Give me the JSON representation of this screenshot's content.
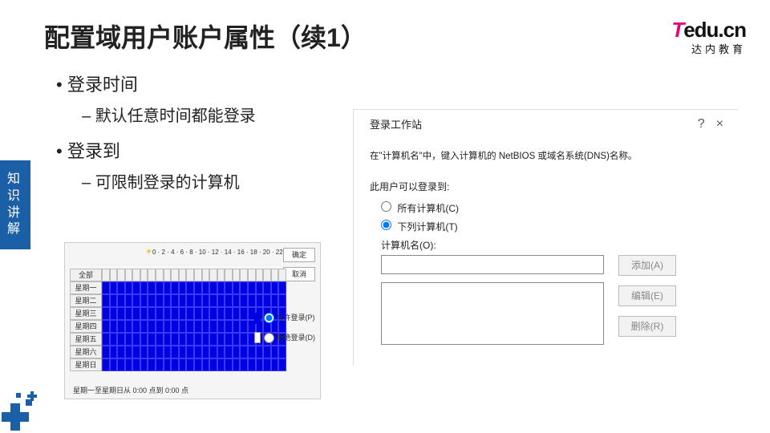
{
  "slide": {
    "title": "配置域用户账户属性（续1）",
    "side_tab": "知识讲解",
    "logo": {
      "t": "T",
      "rest": "edu.cn",
      "sub": "达内教育"
    }
  },
  "bullets": {
    "item1": "登录时间",
    "item1_sub": "默认任意时间都能登录",
    "item2": "登录到",
    "item2_sub": "可限制登录的计算机"
  },
  "hours_dialog": {
    "ticks": "0 · 2 · 4 · 6 · 8 · 10 · 12 · 14 · 16 · 18 · 20 · 22 · 0",
    "ok": "确定",
    "cancel": "取消",
    "days": [
      "全部",
      "星期一",
      "星期二",
      "星期三",
      "星期四",
      "星期五",
      "星期六",
      "星期日"
    ],
    "allow": "允许登录(P)",
    "deny": "拒绝登录(D)",
    "footer": "星期一至星期日从 0:00 点到 0:00 点"
  },
  "ws_dialog": {
    "title": "登录工作站",
    "help_icon": "?",
    "close_icon": "×",
    "desc": "在\"计算机名\"中，键入计算机的 NetBIOS 或域名系统(DNS)名称。",
    "section": "此用户可以登录到:",
    "radio_all": "所有计算机(C)",
    "radio_following": "下列计算机(T)",
    "computer_name_label": "计算机名(O):",
    "add": "添加(A)",
    "edit": "编辑(E)",
    "remove": "删除(R)"
  }
}
